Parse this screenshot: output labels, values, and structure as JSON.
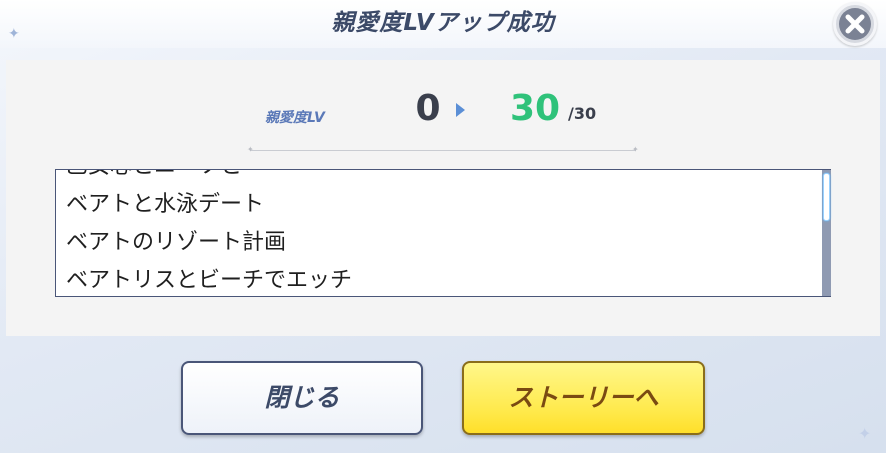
{
  "dialog": {
    "title": "親愛度LVアップ成功"
  },
  "level": {
    "label": "親愛度LV",
    "from": "0",
    "to": "30",
    "max": "/30"
  },
  "stories": [
    "乙女心とニーソと",
    "ベアトと水泳デート",
    "ベアトのリゾート計画",
    "ベアトリスとビーチでエッチ"
  ],
  "buttons": {
    "close_label": "閉じる",
    "story_label": "ストーリーへ"
  },
  "icons": {
    "close": "close-x-icon",
    "arrow": "right-arrow-icon",
    "sparkle": "sparkle-icon"
  },
  "colors": {
    "title": "#3c4a68",
    "level_from": "#3a3f4c",
    "level_to": "#2fc27a",
    "story_button": "#ffe94a"
  }
}
